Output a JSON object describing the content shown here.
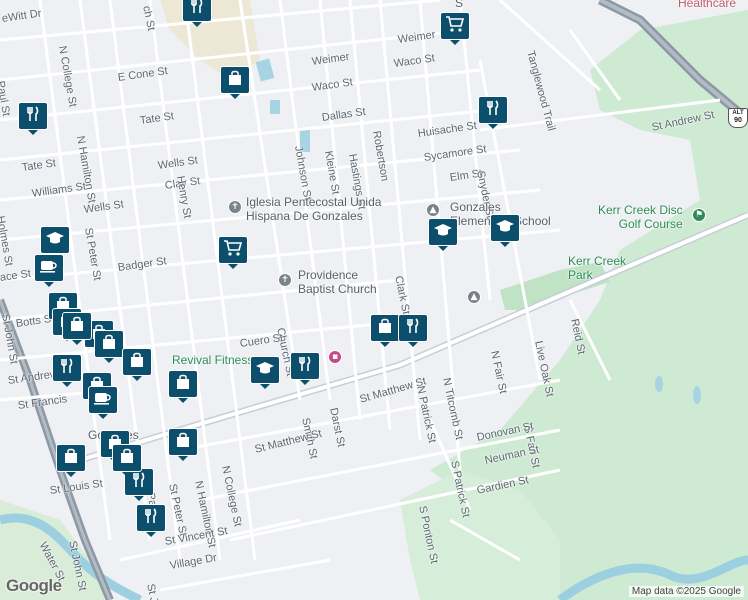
{
  "map": {
    "attribution": "Map data ©2025 Google",
    "logo": "Google",
    "route_shield": {
      "top": "ALT",
      "number": "90"
    },
    "partial_labels": [
      {
        "name": "partial-poi-top",
        "text": "S"
      },
      {
        "name": "partial-poi-healthcare",
        "text": "Healthcare"
      }
    ],
    "streets": [
      {
        "name": "st-dewitt-dr",
        "text": "eWitt Dr"
      },
      {
        "name": "st-n-college-1",
        "text": "N College St"
      },
      {
        "name": "st-paul-1",
        "text": "Paul St"
      },
      {
        "name": "st-e-cone",
        "text": "E Cone St"
      },
      {
        "name": "st-tate-1",
        "text": "Tate St"
      },
      {
        "name": "st-tate-2",
        "text": "Tate St"
      },
      {
        "name": "st-n-hamilton-1",
        "text": "N Hamilton St"
      },
      {
        "name": "st-wells-1",
        "text": "Wells St"
      },
      {
        "name": "st-wells-2",
        "text": "Wells St"
      },
      {
        "name": "st-clay",
        "text": "Clay St"
      },
      {
        "name": "st-williams",
        "text": "Williams St"
      },
      {
        "name": "st-henry",
        "text": "Henry St"
      },
      {
        "name": "st-holmes",
        "text": "Holmes St"
      },
      {
        "name": "st-st-peter-1",
        "text": "St Peter St"
      },
      {
        "name": "st-badger",
        "text": "Badger St"
      },
      {
        "name": "st-ace",
        "text": "ace St"
      },
      {
        "name": "st-st-john-1",
        "text": "St John St"
      },
      {
        "name": "st-botts",
        "text": "Botts St"
      },
      {
        "name": "st-st-andrew-1",
        "text": "St Andrew"
      },
      {
        "name": "st-st-francis",
        "text": "St Francis"
      },
      {
        "name": "st-weimer-1",
        "text": "Weimer"
      },
      {
        "name": "st-weimer-2",
        "text": "Weimer"
      },
      {
        "name": "st-waco-1",
        "text": "Waco St"
      },
      {
        "name": "st-waco-2",
        "text": "Waco St"
      },
      {
        "name": "st-dallas",
        "text": "Dallas St"
      },
      {
        "name": "st-johnson",
        "text": "Johnson St"
      },
      {
        "name": "st-kleine",
        "text": "Kleine St"
      },
      {
        "name": "st-hastings",
        "text": "Hastings St"
      },
      {
        "name": "st-robertson",
        "text": "Robertson"
      },
      {
        "name": "st-huisache",
        "text": "Huisache St"
      },
      {
        "name": "st-sycamore",
        "text": "Sycamore St"
      },
      {
        "name": "st-elm",
        "text": "Elm St"
      },
      {
        "name": "st-snyder",
        "text": "Snyder St"
      },
      {
        "name": "st-tanglewood",
        "text": "Tanglewood Trail"
      },
      {
        "name": "st-st-andrew-2",
        "text": "St Andrew St"
      },
      {
        "name": "st-clark",
        "text": "Clark St"
      },
      {
        "name": "st-church",
        "text": "Church St"
      },
      {
        "name": "st-cuero",
        "text": "Cuero St"
      },
      {
        "name": "st-smith",
        "text": "Smith St"
      },
      {
        "name": "st-darst",
        "text": "Darst St"
      },
      {
        "name": "st-st-matthew-1",
        "text": "St Matthew St"
      },
      {
        "name": "st-st-matthew-2",
        "text": "St Matthew St"
      },
      {
        "name": "st-n-patrick",
        "text": "N Patrick St"
      },
      {
        "name": "st-n-titcomb",
        "text": "N Titcomb St"
      },
      {
        "name": "st-n-fair",
        "text": "N Fair St"
      },
      {
        "name": "st-live-oak",
        "text": "Live Oak St"
      },
      {
        "name": "st-reid",
        "text": "Reid St"
      },
      {
        "name": "st-s-fair",
        "text": "S Fair St"
      },
      {
        "name": "st-donovan",
        "text": "Donovan St"
      },
      {
        "name": "st-s-patrick",
        "text": "S Patrick St"
      },
      {
        "name": "st-neuman",
        "text": "Neuman St"
      },
      {
        "name": "st-gardien",
        "text": "Gardien St"
      },
      {
        "name": "st-s-ponton",
        "text": "S Ponton St"
      },
      {
        "name": "st-n-college-2",
        "text": "N College St"
      },
      {
        "name": "st-n-hamilton-2",
        "text": "N Hamilton St"
      },
      {
        "name": "st-st-peter-2",
        "text": "St Peter St"
      },
      {
        "name": "st-paul-2",
        "text": "Paul St"
      },
      {
        "name": "st-st-louis",
        "text": "St Louis St"
      },
      {
        "name": "st-st-john-2",
        "text": "St John St"
      },
      {
        "name": "st-water",
        "text": "Water St"
      },
      {
        "name": "st-st-vincent",
        "text": "St Vincent St"
      },
      {
        "name": "st-village",
        "text": "Village Dr"
      },
      {
        "name": "st-st-jo",
        "text": "St Jo"
      },
      {
        "name": "st-ch-top",
        "text": "ch St"
      }
    ],
    "pois": [
      {
        "name": "poi-iglesia",
        "text": "Iglesia Pentecostal Unida\nHispana De Gonzales",
        "icon": "cross-icon",
        "color": "gray"
      },
      {
        "name": "poi-providence",
        "text": "Providence\nBaptist Church",
        "icon": "cross-icon",
        "color": "gray"
      },
      {
        "name": "poi-gonzales-school",
        "text": "Gonzales\nElementary School",
        "icon": "school-icon",
        "color": "gray"
      },
      {
        "name": "poi-kerr-creek-disc",
        "text": "Kerr Creek Disc\nGolf Course",
        "icon": "golf-icon",
        "color": "green"
      },
      {
        "name": "poi-kerr-creek-park",
        "text": "Kerr Creek\nPark",
        "icon": "park-icon",
        "color": "green"
      },
      {
        "name": "poi-revival-fitness",
        "text": "Revival Fitness",
        "icon": "gym-icon",
        "color": "green"
      },
      {
        "name": "poi-gonzales",
        "text": "Gonzales",
        "icon": "",
        "color": "gray"
      }
    ],
    "markers": [
      {
        "name": "marker-restaurant-1",
        "icon": "restaurant-icon"
      },
      {
        "name": "marker-grocery-1",
        "icon": "cart-icon"
      },
      {
        "name": "marker-shopping-1",
        "icon": "bag-icon"
      },
      {
        "name": "marker-restaurant-2",
        "icon": "restaurant-icon"
      },
      {
        "name": "marker-restaurant-3",
        "icon": "restaurant-icon"
      },
      {
        "name": "marker-school-1",
        "icon": "school-icon"
      },
      {
        "name": "marker-school-2",
        "icon": "school-icon"
      },
      {
        "name": "marker-school-3",
        "icon": "school-icon"
      },
      {
        "name": "marker-grocery-2",
        "icon": "cart-icon"
      },
      {
        "name": "marker-cafe-1",
        "icon": "coffee-icon"
      },
      {
        "name": "marker-shopping-2",
        "icon": "bag-icon"
      },
      {
        "name": "marker-shopping-3",
        "icon": "bag-icon"
      },
      {
        "name": "marker-shopping-4",
        "icon": "bag-icon"
      },
      {
        "name": "marker-shopping-5",
        "icon": "bag-icon"
      },
      {
        "name": "marker-shopping-6",
        "icon": "bag-icon"
      },
      {
        "name": "marker-restaurant-4",
        "icon": "restaurant-icon"
      },
      {
        "name": "marker-school-4",
        "icon": "school-icon"
      },
      {
        "name": "marker-shopping-7",
        "icon": "bag-icon"
      },
      {
        "name": "marker-restaurant-5",
        "icon": "restaurant-icon"
      },
      {
        "name": "marker-restaurant-6",
        "icon": "restaurant-icon"
      },
      {
        "name": "marker-shopping-8",
        "icon": "bag-icon"
      },
      {
        "name": "marker-shopping-9",
        "icon": "bag-icon"
      },
      {
        "name": "marker-cafe-2",
        "icon": "coffee-icon"
      },
      {
        "name": "marker-shopping-10",
        "icon": "bag-icon"
      },
      {
        "name": "marker-shopping-11",
        "icon": "bag-icon"
      },
      {
        "name": "marker-shopping-12",
        "icon": "bag-icon"
      },
      {
        "name": "marker-restaurant-7",
        "icon": "restaurant-icon"
      },
      {
        "name": "marker-restaurant-8",
        "icon": "restaurant-icon"
      },
      {
        "name": "marker-shopping-13",
        "icon": "bag-icon"
      },
      {
        "name": "marker-shopping-14",
        "icon": "bag-icon"
      }
    ],
    "colors": {
      "marker": "#0b4f6c",
      "park": "#c9e9cf",
      "water": "#9ccfe0",
      "highway": "#8e9aa6",
      "road": "#ffffff"
    }
  }
}
